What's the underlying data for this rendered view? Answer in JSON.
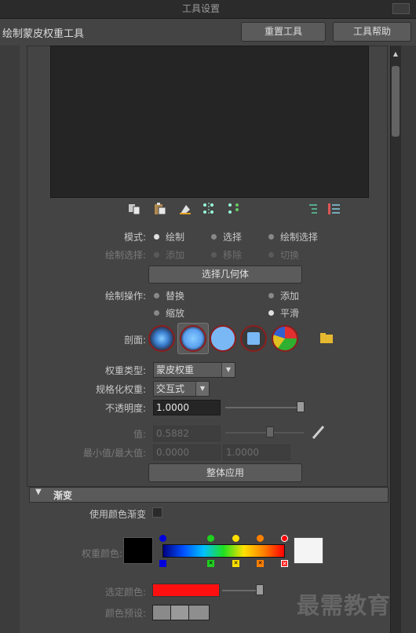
{
  "window": {
    "title": "工具设置"
  },
  "header": {
    "title": "绘制蒙皮权重工具",
    "reset_label": "重置工具",
    "help_label": "工具帮助"
  },
  "toolbar": {
    "icons": [
      "copy-icon",
      "paste-icon",
      "flood-icon",
      "mirror-icon",
      "transfer-icon",
      "list-tree-icon",
      "list-bar-icon"
    ]
  },
  "mode": {
    "label": "模式:",
    "options": [
      "绘制",
      "选择",
      "绘制选择"
    ],
    "selected": "绘制"
  },
  "paint_select": {
    "label": "绘制选择:",
    "options": [
      "添加",
      "移除",
      "切换"
    ],
    "selected": "添加"
  },
  "select_geometry_label": "选择几何体",
  "paint_operation": {
    "label": "绘制操作:",
    "options": [
      "替换",
      "添加",
      "缩放",
      "平滑"
    ],
    "selected": "平滑"
  },
  "profile": {
    "label": "剖面:",
    "brushes": [
      "gaussian",
      "soft",
      "solid",
      "square",
      "image"
    ],
    "selected": "soft"
  },
  "weight_type": {
    "label": "权重类型:",
    "value": "蒙皮权重"
  },
  "normalize": {
    "label": "规格化权重:",
    "value": "交互式"
  },
  "opacity": {
    "label": "不透明度:",
    "value": "1.0000",
    "level": 1.0
  },
  "value": {
    "label": "值:",
    "value": "0.5882",
    "level": 0.5882
  },
  "minmax": {
    "label": "最小值/最大值:",
    "min": "0.0000",
    "max": "1.0000"
  },
  "flood_label": "整体应用",
  "gradient_section": {
    "title": "渐变",
    "use_color_gradient": "使用颜色渐变",
    "weight_color_label": "权重颜色:",
    "selected_color_label": "选定颜色:",
    "color_presets_label": "颜色预设:",
    "selected_color": "#ff1010",
    "gradient_markers": [
      "#0000dd",
      "#20d020",
      "#ffe000",
      "#ff8000",
      "#ff0000"
    ]
  },
  "watermark": "最需教育"
}
